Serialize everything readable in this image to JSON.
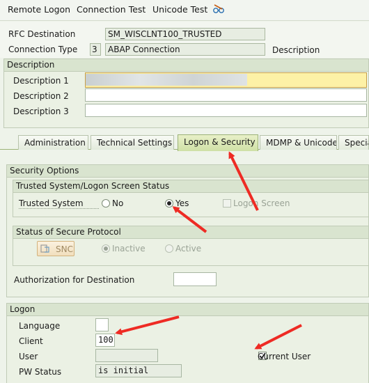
{
  "toolbar": {
    "remote_logon": "Remote Logon",
    "connection_test": "Connection Test",
    "unicode_test": "Unicode Test"
  },
  "header": {
    "rfc_destination_label": "RFC Destination",
    "rfc_destination_value": "SM_WISCLNT100_TRUSTED",
    "connection_type_label": "Connection Type",
    "connection_type_code": "3",
    "connection_type_value": "ABAP Connection",
    "description_label": "Description"
  },
  "description_section": {
    "title": "Description",
    "desc1_label": "Description 1",
    "desc2_label": "Description 2",
    "desc3_label": "Description 3"
  },
  "tabs": [
    {
      "label": "Administration",
      "active": false
    },
    {
      "label": "Technical Settings",
      "active": false
    },
    {
      "label": "Logon & Security",
      "active": true
    },
    {
      "label": "MDMP & Unicode",
      "active": false
    },
    {
      "label": "Special",
      "active": false
    }
  ],
  "security": {
    "title": "Security Options",
    "trusted_title": "Trusted System/Logon Screen Status",
    "trusted_system_label": "Trusted System",
    "no_label": "No",
    "yes_label": "Yes",
    "logon_screen_label": "Logon Screen",
    "selected": "Yes",
    "protocol_title": "Status of Secure Protocol",
    "snc_button": "SNC",
    "inactive_label": "Inactive",
    "active_label": "Active",
    "protocol_selected": "Inactive",
    "auth_label": "Authorization for Destination"
  },
  "logon": {
    "title": "Logon",
    "language_label": "Language",
    "client_label": "Client",
    "client_value": "100",
    "user_label": "User",
    "pw_status_label": "PW Status",
    "pw_status_value": "is initial",
    "current_user_label": "Current User",
    "current_user_checked": true
  },
  "colors": {
    "annotation_arrow": "#ee2b24",
    "highlight_field": "#fdf1a6",
    "active_tab": "#cfe0a6"
  }
}
